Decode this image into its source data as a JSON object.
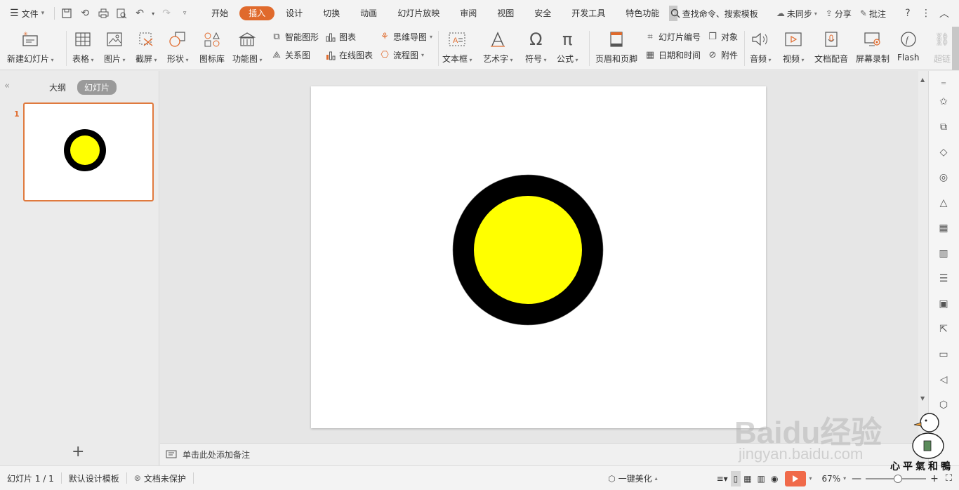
{
  "menubar": {
    "file_label": "文件",
    "tabs": [
      {
        "label": "开始"
      },
      {
        "label": "插入",
        "active": true
      },
      {
        "label": "设计"
      },
      {
        "label": "切换"
      },
      {
        "label": "动画"
      },
      {
        "label": "幻灯片放映"
      },
      {
        "label": "审阅"
      },
      {
        "label": "视图"
      },
      {
        "label": "安全"
      },
      {
        "label": "开发工具"
      },
      {
        "label": "特色功能"
      }
    ],
    "search_label": "查找命令、搜索模板",
    "sync_label": "未同步",
    "share_label": "分享",
    "comment_label": "批注"
  },
  "ribbon": {
    "new_slide": "新建幻灯片",
    "table": "表格",
    "picture": "图片",
    "screenshot": "截屏",
    "shape": "形状",
    "icon_library": "图标库",
    "function_chart": "功能图",
    "smart_graphic": "智能图形",
    "chart": "图表",
    "relation_chart": "关系图",
    "online_chart": "在线图表",
    "mind_map": "思维导图",
    "flowchart": "流程图",
    "textbox": "文本框",
    "art_text": "艺术字",
    "symbol": "符号",
    "formula": "公式",
    "header_footer": "页眉和页脚",
    "slide_number": "幻灯片编号",
    "object": "对象",
    "date_time": "日期和时间",
    "attachment": "附件",
    "audio": "音频",
    "video": "视频",
    "doc_dubbing": "文档配音",
    "screen_record": "屏幕录制",
    "flash": "Flash",
    "hyperlink": "超链"
  },
  "left_panel": {
    "tab_outline": "大纲",
    "tab_slides": "幻灯片",
    "slide_number": "1"
  },
  "notes": {
    "placeholder": "单击此处添加备注"
  },
  "slide": {
    "outer_color": "#000000",
    "inner_color": "#ffff00"
  },
  "statusbar": {
    "slide_info": "幻灯片 1 / 1",
    "template": "默认设计模板",
    "protection": "文档未保护",
    "beautify": "一键美化",
    "zoom": "67%"
  },
  "watermark": {
    "brand": "Baidu经验",
    "url": "jingyan.baidu.com",
    "tagline": "心平氣和鴨"
  }
}
